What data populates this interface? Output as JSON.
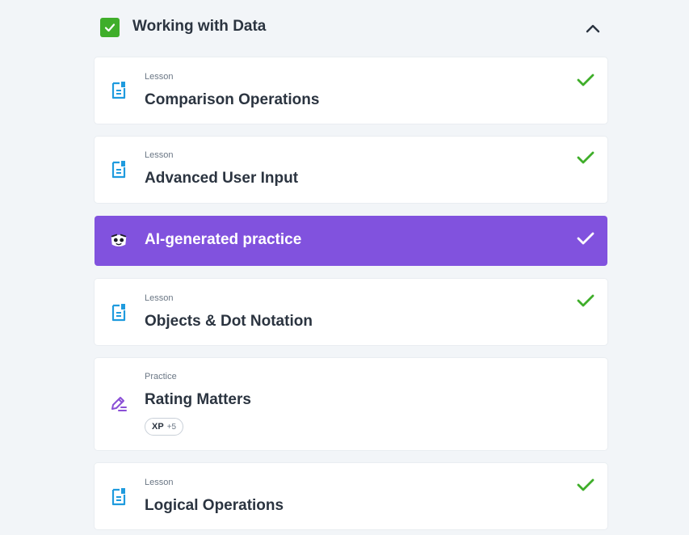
{
  "section": {
    "title": "Working with Data",
    "completed": true
  },
  "items": [
    {
      "kind": "Lesson",
      "title": "Comparison Operations",
      "completed": true,
      "icon": "lesson-doc-icon"
    },
    {
      "kind": "Lesson",
      "title": "Advanced User Input",
      "completed": true,
      "icon": "lesson-doc-icon"
    },
    {
      "kind": "",
      "title": "AI-generated practice",
      "completed": true,
      "icon": "ai-mascot-icon"
    },
    {
      "kind": "Lesson",
      "title": "Objects & Dot Notation",
      "completed": true,
      "icon": "lesson-doc-icon"
    },
    {
      "kind": "Practice",
      "title": "Rating Matters",
      "completed": false,
      "icon": "practice-pencil-icon",
      "xp": {
        "label": "XP",
        "value": "+5"
      }
    },
    {
      "kind": "Lesson",
      "title": "Logical Operations",
      "completed": true,
      "icon": "lesson-doc-icon"
    }
  ],
  "colors": {
    "accent_green": "#3fae2a",
    "ai_purple": "#8152de",
    "lesson_blue": "#1f9bde",
    "practice_purple": "#8a4fd6"
  }
}
